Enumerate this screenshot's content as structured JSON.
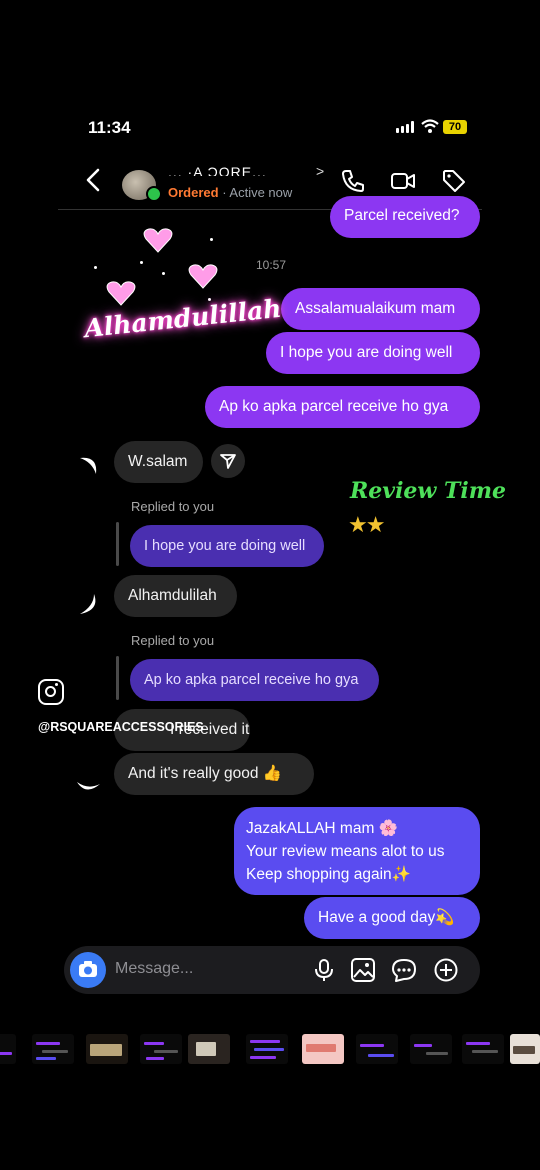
{
  "status_bar": {
    "time": "11:34",
    "battery": "70"
  },
  "header": {
    "title": "... ·A ƆORE...",
    "chevron": ">",
    "status_label": "Ordered",
    "status_sep": " · ",
    "status_active": "Active now"
  },
  "messages": {
    "partial_top": "Parcel received?",
    "timestamp": "10:57",
    "out1": "Assalamualaikum mam",
    "out2": "I hope you are doing well",
    "out3": "Ap ko apka parcel receive ho gya",
    "in1": "W.salam",
    "reply_label_1": "Replied to you",
    "reply_quote_1": "I hope you are doing well",
    "in2": "Alhamdulilah",
    "reply_label_2": "Replied to you",
    "reply_quote_2": "Ap ko apka parcel receive ho gya",
    "in3": "I received it",
    "in4": "And it's really good 👍",
    "out4_line1": "JazakALLAH mam 🌸",
    "out4_line2": "Your review means alot to us",
    "out4_line3": "Keep shopping again✨",
    "out5": "Have a good day💫"
  },
  "overlay": {
    "alhamdulillah": "Alhamdulillah",
    "review_time": "Review Time",
    "stars": "★★",
    "instagram_handle": "@RSQUAREACCESSORIES"
  },
  "composer": {
    "placeholder": "Message..."
  },
  "colors": {
    "outgoing": "#8c37f2",
    "outgoing_blue": "#5a4cf0",
    "incoming": "#262626",
    "online": "#2dc44b",
    "ordered": "#ff7a33"
  },
  "icons": [
    "back-chevron-icon",
    "phone-icon",
    "video-icon",
    "tag-icon",
    "send-icon",
    "camera-icon",
    "microphone-icon",
    "gallery-icon",
    "sticker-icon",
    "plus-icon",
    "instagram-icon"
  ]
}
